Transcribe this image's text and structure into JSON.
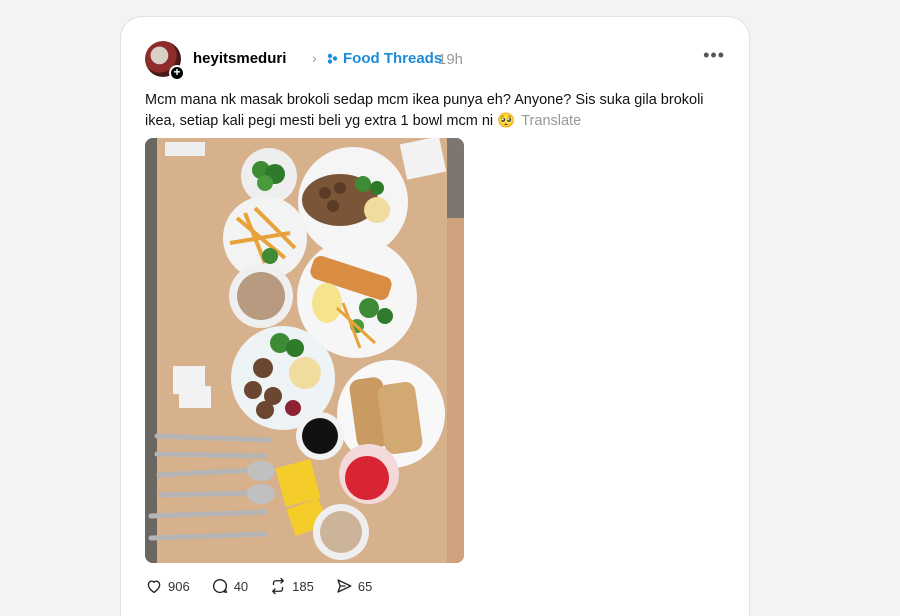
{
  "post": {
    "username": "heyitsmeduri",
    "topic": "Food Threads",
    "time": "19h",
    "text": "Mcm mana nk masak brokoli sedap mcm ikea punya eh? Anyone? Sis suka gila brokoli ikea, setiap kali pegi mesti beli yg extra 1 bowl mcm ni 🥺",
    "translate_label": "Translate",
    "image_alt": "IKEA meal on a wooden table with broccoli, meatballs, fish and chips, soup, toast and drinks"
  },
  "actions": {
    "likes": "906",
    "comments": "40",
    "reposts": "185",
    "shares": "65"
  },
  "icons": {
    "avatar_add": "plus-icon",
    "chevron": "chevron-right-icon",
    "topic": "threads-topic-icon",
    "more": "more-horizontal-icon",
    "like": "heart-icon",
    "comment": "comment-icon",
    "repost": "repost-icon",
    "share": "share-icon"
  },
  "colors": {
    "topic": "#1c8cd8",
    "muted": "#999999"
  }
}
